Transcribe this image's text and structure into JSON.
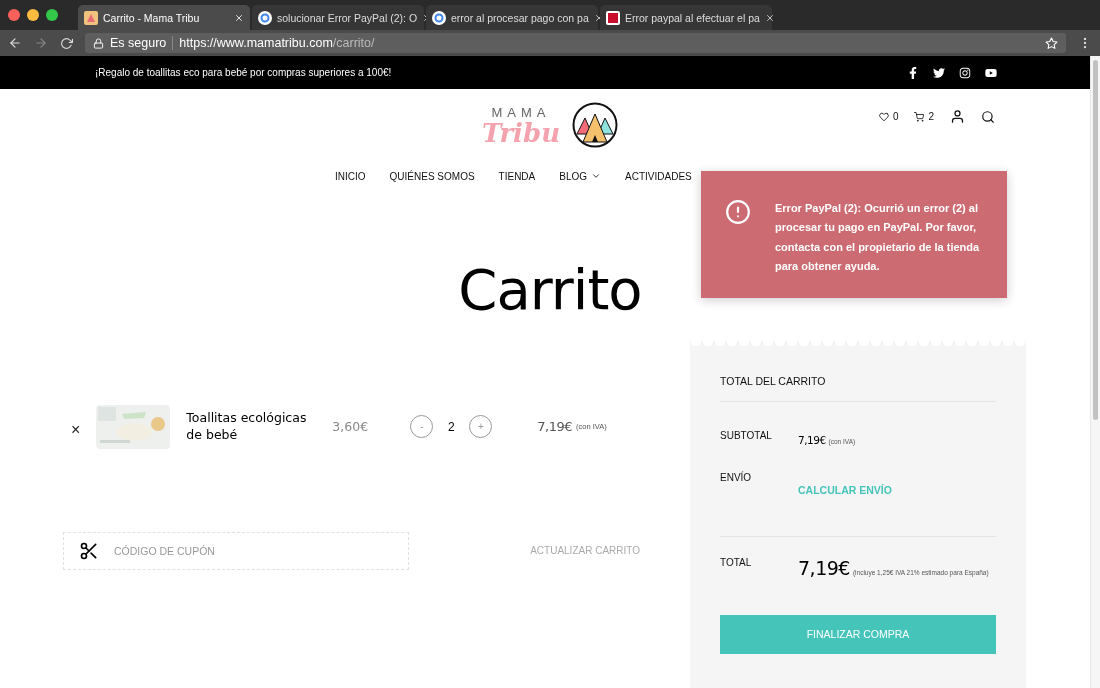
{
  "browser": {
    "tabs": [
      {
        "title": "Carrito - Mama Tribu",
        "selected": true
      },
      {
        "title": "solucionar Error PayPal (2): O",
        "selected": false
      },
      {
        "title": "error al procesar pago con pa",
        "selected": false
      },
      {
        "title": "Error paypal al efectuar el pa",
        "selected": false
      }
    ],
    "secure_label": "Es seguro",
    "url": {
      "origin": "https://www.mamatribu.com",
      "path": "/carrito/"
    }
  },
  "top_bar": {
    "promo": "¡Regalo de toallitas eco para bebé por compras superiores a 100€!"
  },
  "header": {
    "logo": {
      "top": "MAMA",
      "bottom": "Tribu"
    },
    "wishlist_count": "0",
    "cart_count": "2"
  },
  "nav": [
    {
      "label": "INICIO",
      "has_dropdown": false
    },
    {
      "label": "QUIÉNES SOMOS",
      "has_dropdown": false
    },
    {
      "label": "TIENDA",
      "has_dropdown": false
    },
    {
      "label": "BLOG",
      "has_dropdown": true
    },
    {
      "label": "ACTIVIDADES",
      "has_dropdown": false
    }
  ],
  "page_title": "Carrito",
  "cart": {
    "items": [
      {
        "remove": "×",
        "name": "Toallitas ecológicas de bebé",
        "price": "3,60€",
        "minus": "-",
        "quantity": "2",
        "plus": "+",
        "subtotal": "7,19€",
        "subtotal_note": "(con IVA)"
      }
    ],
    "coupon": {
      "placeholder": "CÓDIGO DE CUPÓN"
    },
    "update_button": "ACTUALIZAR CARRITO"
  },
  "totals": {
    "title": "TOTAL DEL CARRITO",
    "subtotal_label": "SUBTOTAL",
    "subtotal": "7,19€",
    "subtotal_note": "(con IVA)",
    "shipping_label": "ENVÍO",
    "shipping_link": "CALCULAR ENVÍO",
    "total_label": "TOTAL",
    "total": "7,19€",
    "total_note": "(incluye 1,25€ IVA 21% estimado para España)",
    "checkout_button": "FINALIZAR COMPRA"
  },
  "toast": {
    "kind": "error",
    "message": "Error PayPal (2): Ocurrió un error (2) al procesar tu pago en PayPal. Por favor, contacta con el propietario de la tienda para obtener ayuda."
  }
}
